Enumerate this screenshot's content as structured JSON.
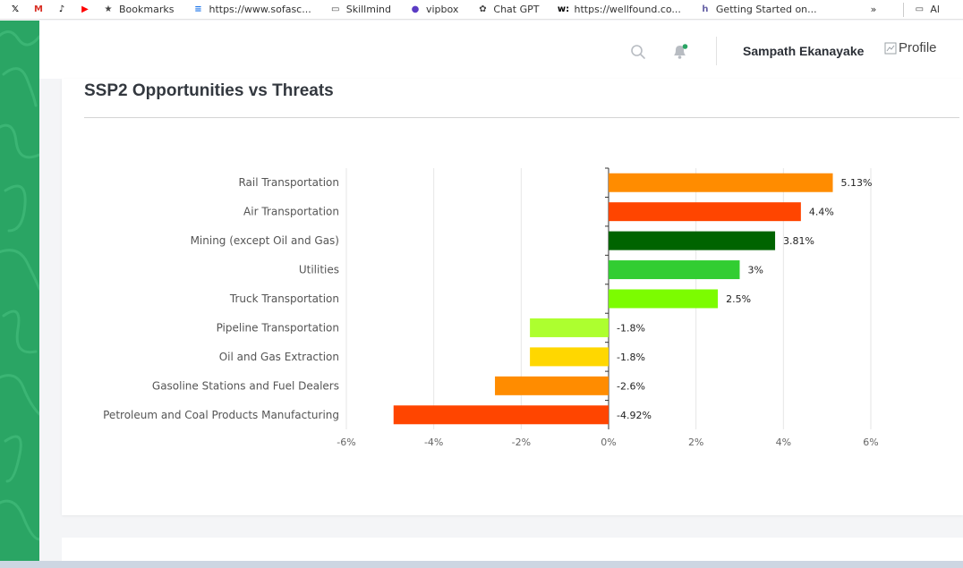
{
  "bookmarks_bar": {
    "items": [
      {
        "label": "",
        "icon": "x-logo-icon",
        "color": "#000000"
      },
      {
        "label": "",
        "icon": "gmail-icon",
        "color": "#d93025"
      },
      {
        "label": "",
        "icon": "tiktok-icon",
        "color": "#000000"
      },
      {
        "label": "",
        "icon": "youtube-icon",
        "color": "#ff0000"
      },
      {
        "label": "Bookmarks",
        "icon": "star-icon",
        "color": "#444444"
      },
      {
        "label": "https://www.sofasc...",
        "icon": "site-icon",
        "color": "#1a73e8"
      },
      {
        "label": "Skillmind",
        "icon": "folder-icon",
        "color": "#444444"
      },
      {
        "label": "vipbox",
        "icon": "vipbox-icon",
        "color": "#5b3cc4"
      },
      {
        "label": "Chat GPT",
        "icon": "openai-icon",
        "color": "#444444"
      },
      {
        "label": "https://wellfound.co...",
        "icon": "wellfound-icon",
        "color": "#000000"
      },
      {
        "label": "Getting Started on...",
        "icon": "heroku-icon",
        "color": "#6762a6"
      }
    ],
    "overflow": "»",
    "trailing_folder": "Al"
  },
  "header": {
    "user_name": "Sampath Ekanayake",
    "profile_alt": "Profile",
    "notification_dot_color": "#2aa564"
  },
  "card": {
    "title": "SSP2 Opportunities vs Threats"
  },
  "chart_data": {
    "type": "bar",
    "orientation": "horizontal",
    "categories": [
      "Rail Transportation",
      "Air Transportation",
      "Mining (except Oil and Gas)",
      "Utilities",
      "Truck Transportation",
      "Pipeline Transportation",
      "Oil and Gas Extraction",
      "Gasoline Stations and Fuel Dealers",
      "Petroleum and Coal Products Manufacturing"
    ],
    "values": [
      5.13,
      4.4,
      3.81,
      3,
      2.5,
      -1.8,
      -1.8,
      -2.6,
      -4.92
    ],
    "data_labels": [
      "5.13%",
      "4.4%",
      "3.81%",
      "3%",
      "2.5%",
      "-1.8%",
      "-1.8%",
      "-2.6%",
      "-4.92%"
    ],
    "colors": [
      "#ff8c00",
      "#ff4500",
      "#006400",
      "#32cd32",
      "#7cfc00",
      "#adff2f",
      "#ffd700",
      "#ff8c00",
      "#ff4500"
    ],
    "xlim": [
      -6,
      6
    ],
    "xticks": [
      -6,
      -4,
      -2,
      0,
      2,
      4,
      6
    ],
    "xtick_labels": [
      "-6%",
      "-4%",
      "-2%",
      "0%",
      "2%",
      "4%",
      "6%"
    ],
    "grid": true
  }
}
